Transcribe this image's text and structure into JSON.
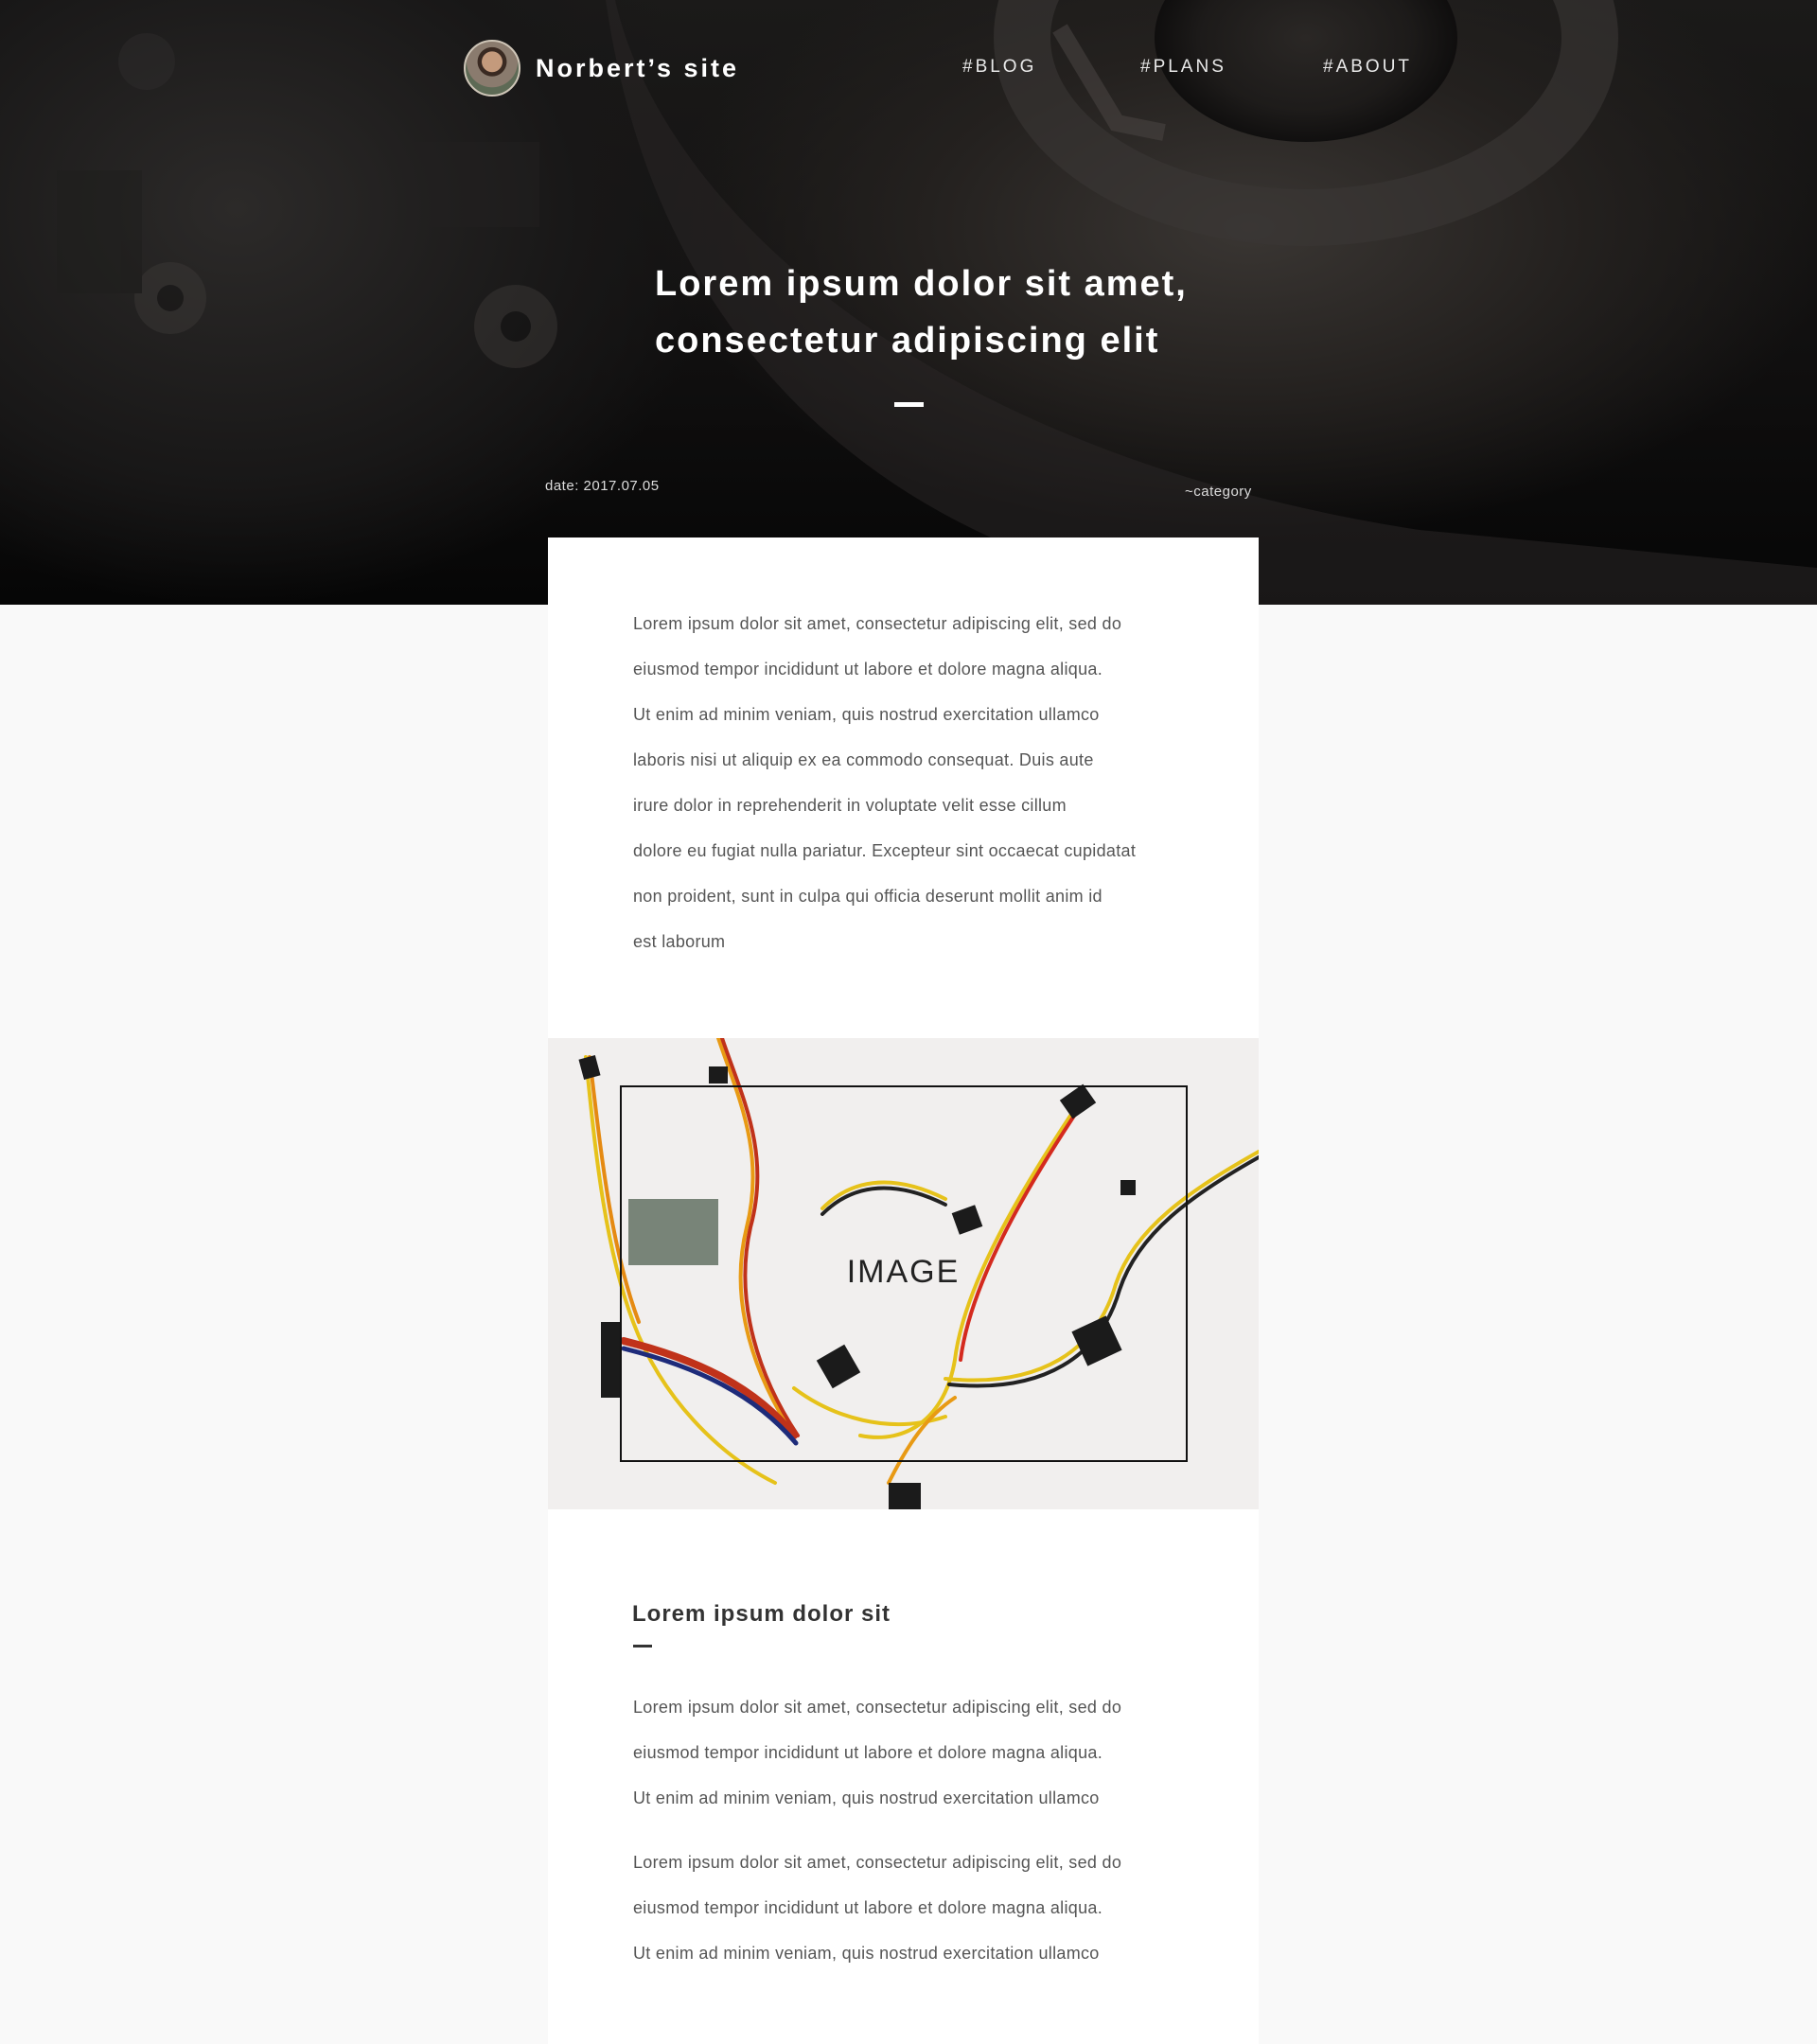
{
  "header": {
    "site_name": "Norbert’s site",
    "nav": [
      {
        "label": "#BLOG"
      },
      {
        "label": "#PLANS"
      },
      {
        "label": "#ABOUT"
      }
    ]
  },
  "hero": {
    "title_line1": "Lorem ipsum dolor sit amet,",
    "title_line2": "consectetur adipiscing elit",
    "date": "date: 2017.07.05",
    "category": "~category"
  },
  "article": {
    "intro_lines": [
      "Lorem ipsum dolor sit amet, consectetur adipiscing elit, sed do",
      "eiusmod tempor incididunt ut labore et dolore magna aliqua.",
      "Ut enim ad minim veniam, quis nostrud exercitation ullamco",
      "laboris nisi ut aliquip ex ea commodo consequat. Duis aute",
      "irure dolor in reprehenderit in voluptate velit esse cillum",
      "dolore eu fugiat nulla pariatur. Excepteur sint occaecat cupidatat",
      "non proident, sunt in culpa qui officia deserunt mollit anim id",
      "est laborum"
    ],
    "image_label": "IMAGE",
    "subheading": "Lorem ipsum dolor sit",
    "para2_lines": [
      "Lorem ipsum dolor sit amet, consectetur adipiscing elit, sed do",
      "eiusmod tempor incididunt ut labore et dolore magna aliqua.",
      "Ut enim ad minim veniam, quis nostrud exercitation ullamco"
    ],
    "para3_lines": [
      "Lorem ipsum dolor sit amet, consectetur adipiscing elit, sed do",
      "eiusmod tempor incididunt ut labore et dolore magna aliqua.",
      "Ut enim ad minim veniam, quis nostrud exercitation ullamco"
    ]
  }
}
